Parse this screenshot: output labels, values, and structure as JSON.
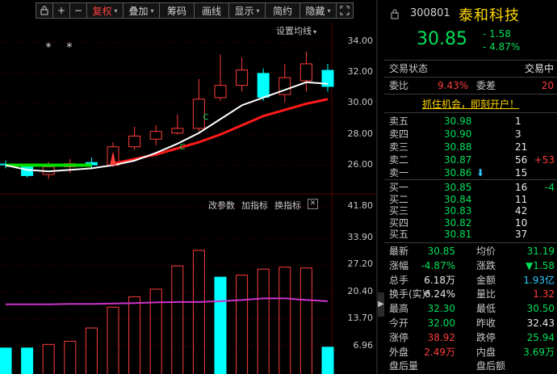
{
  "toolbar": {
    "lock_icon": "lock-icon",
    "plus": "+",
    "minus": "−",
    "restore_rights": "复权",
    "overlay": "叠加",
    "chips": "筹码",
    "draw_line": "画线",
    "display": "显示",
    "simple": "简约",
    "hide": "隐藏",
    "fullscreen_icon": "fullscreen-icon",
    "caret": "▾"
  },
  "chart": {
    "set_ma_label": "设置均线",
    "star_marks": [
      "*",
      "*"
    ],
    "c_marks": [
      "C",
      "C"
    ],
    "vol_tools": {
      "params": "改参数",
      "add_indicator": "加指标",
      "switch_indicator": "换指标",
      "close": "✕"
    },
    "collapse_arrow": "▶"
  },
  "chart_data": [
    {
      "type": "candlestick",
      "y_ticks": [
        "34.00",
        "32.00",
        "30.00",
        "28.00",
        "26.00"
      ],
      "ylim": [
        24.4,
        35.7
      ],
      "candles": [
        {
          "o": 26.1,
          "c": 26.0,
          "h": 26.3,
          "l": 25.8
        },
        {
          "o": 26.0,
          "c": 25.3,
          "h": 26.1,
          "l": 25.2
        },
        {
          "o": 25.4,
          "c": 25.9,
          "h": 26.2,
          "l": 25.1
        },
        {
          "o": 25.9,
          "c": 26.1,
          "h": 26.4,
          "l": 25.5
        },
        {
          "o": 26.2,
          "c": 26.0,
          "h": 26.5,
          "l": 25.8
        },
        {
          "o": 26.0,
          "c": 27.2,
          "h": 27.5,
          "l": 25.9
        },
        {
          "o": 27.2,
          "c": 27.9,
          "h": 28.5,
          "l": 27.0
        },
        {
          "o": 27.7,
          "c": 28.2,
          "h": 28.6,
          "l": 27.3
        },
        {
          "o": 28.1,
          "c": 28.4,
          "h": 29.3,
          "l": 28.0
        },
        {
          "o": 28.4,
          "c": 30.3,
          "h": 31.6,
          "l": 28.2
        },
        {
          "o": 30.4,
          "c": 31.2,
          "h": 33.2,
          "l": 30.2
        },
        {
          "o": 31.2,
          "c": 32.2,
          "h": 33.0,
          "l": 30.8
        },
        {
          "o": 32.0,
          "c": 30.4,
          "h": 32.3,
          "l": 30.2
        },
        {
          "o": 30.6,
          "c": 31.7,
          "h": 32.6,
          "l": 30.1
        },
        {
          "o": 31.5,
          "c": 32.6,
          "h": 33.4,
          "l": 30.8
        },
        {
          "o": 32.2,
          "c": 31.1,
          "h": 32.6,
          "l": 30.8
        }
      ],
      "ma_white": [
        26.0,
        25.7,
        25.6,
        25.7,
        25.8,
        26.0,
        26.3,
        26.8,
        27.4,
        28.1,
        29.0,
        29.9,
        30.4,
        30.9,
        31.4,
        31.3
      ],
      "ma_red": [
        null,
        null,
        null,
        null,
        null,
        26.1,
        26.4,
        26.7,
        27.1,
        27.5,
        28.0,
        28.6,
        29.2,
        29.6,
        30.0,
        30.3
      ],
      "ma_green": [
        26.0,
        26.0,
        26.0,
        26.0,
        26.0
      ]
    },
    {
      "type": "bar",
      "y_ticks": [
        "41.80",
        "33.90",
        "27.20",
        "20.40",
        "13.70",
        "6.96"
      ],
      "ylim": [
        0,
        44
      ],
      "values": [
        6.6,
        6.6,
        7.5,
        8.3,
        11.6,
        16.8,
        19.4,
        21.3,
        27.1,
        31.0,
        24.3,
        24.8,
        26.3,
        26.8,
        26.6,
        6.8
      ],
      "colors": [
        "cyan",
        "cyan",
        "red",
        "red",
        "red",
        "red",
        "red",
        "red",
        "red",
        "red",
        "cyan",
        "red",
        "red",
        "red",
        "red",
        "cyan"
      ],
      "ma_line": [
        17.4,
        17.4,
        17.4,
        17.5,
        17.5,
        17.6,
        17.7,
        17.9,
        18.0,
        18.0,
        18.2,
        18.5,
        18.9,
        18.9,
        18.5,
        18.2
      ]
    }
  ],
  "colors": {
    "up": "#ff3c3c",
    "down": "#00ffff",
    "ma_white": "#ffffff",
    "ma_red": "#ff1a1a",
    "ma_green": "#00e000",
    "vol_ma": "#cc33cc",
    "grid": "#5a0000"
  },
  "quote": {
    "code": "300801",
    "name": "泰和科技",
    "price": "30.85",
    "change": "- 1.58",
    "change_pct": "- 4.87%",
    "status_label": "交易状态",
    "status_value": "交易中",
    "ratio_label": "委比",
    "ratio_value": "9.43%",
    "diff_label": "委差",
    "diff_value": "20",
    "promo": "抓住机会，即刻开户！",
    "asks": [
      {
        "label": "卖五",
        "price": "30.98",
        "vol": "1",
        "chg": ""
      },
      {
        "label": "卖四",
        "price": "30.90",
        "vol": "3",
        "chg": ""
      },
      {
        "label": "卖三",
        "price": "30.88",
        "vol": "21",
        "chg": ""
      },
      {
        "label": "卖二",
        "price": "30.87",
        "vol": "56",
        "chg": "+53"
      },
      {
        "label": "卖一",
        "price": "30.86",
        "vol": "15",
        "chg": ""
      }
    ],
    "ask_down_arrow": "⬇",
    "bids": [
      {
        "label": "买一",
        "price": "30.85",
        "vol": "16",
        "chg": "-4"
      },
      {
        "label": "买二",
        "price": "30.84",
        "vol": "11",
        "chg": ""
      },
      {
        "label": "买三",
        "price": "30.83",
        "vol": "42",
        "chg": ""
      },
      {
        "label": "买四",
        "price": "30.82",
        "vol": "10",
        "chg": ""
      },
      {
        "label": "买五",
        "price": "30.81",
        "vol": "37",
        "chg": ""
      }
    ],
    "stats": [
      {
        "l1": "最新",
        "v1": "30.85",
        "c1": "green",
        "l2": "均价",
        "v2": "31.19",
        "c2": "green"
      },
      {
        "l1": "涨幅",
        "v1": "-4.87%",
        "c1": "green",
        "l2": "涨跌",
        "v2": "▼1.58",
        "c2": "green"
      },
      {
        "l1": "总手",
        "v1": "6.18万",
        "c1": "white",
        "l2": "金额",
        "v2": "1.93亿",
        "c2": "cyan"
      },
      {
        "l1": "换手(实)*",
        "v1": "6.24%",
        "c1": "white",
        "l2": "量比",
        "v2": "1.32",
        "c2": "red"
      },
      {
        "l1": "最高",
        "v1": "32.30",
        "c1": "green",
        "l2": "最低",
        "v2": "30.50",
        "c2": "green"
      },
      {
        "l1": "今开",
        "v1": "32.00",
        "c1": "green",
        "l2": "昨收",
        "v2": "32.43",
        "c2": "white"
      },
      {
        "l1": "涨停",
        "v1": "38.92",
        "c1": "red",
        "l2": "跌停",
        "v2": "25.94",
        "c2": "green"
      },
      {
        "l1": "外盘",
        "v1": "2.49万",
        "c1": "red",
        "l2": "内盘",
        "v2": "3.69万",
        "c2": "green"
      },
      {
        "l1": "盘后量",
        "v1": "",
        "c1": "white",
        "l2": "盘后额",
        "v2": "",
        "c2": "white"
      }
    ]
  }
}
